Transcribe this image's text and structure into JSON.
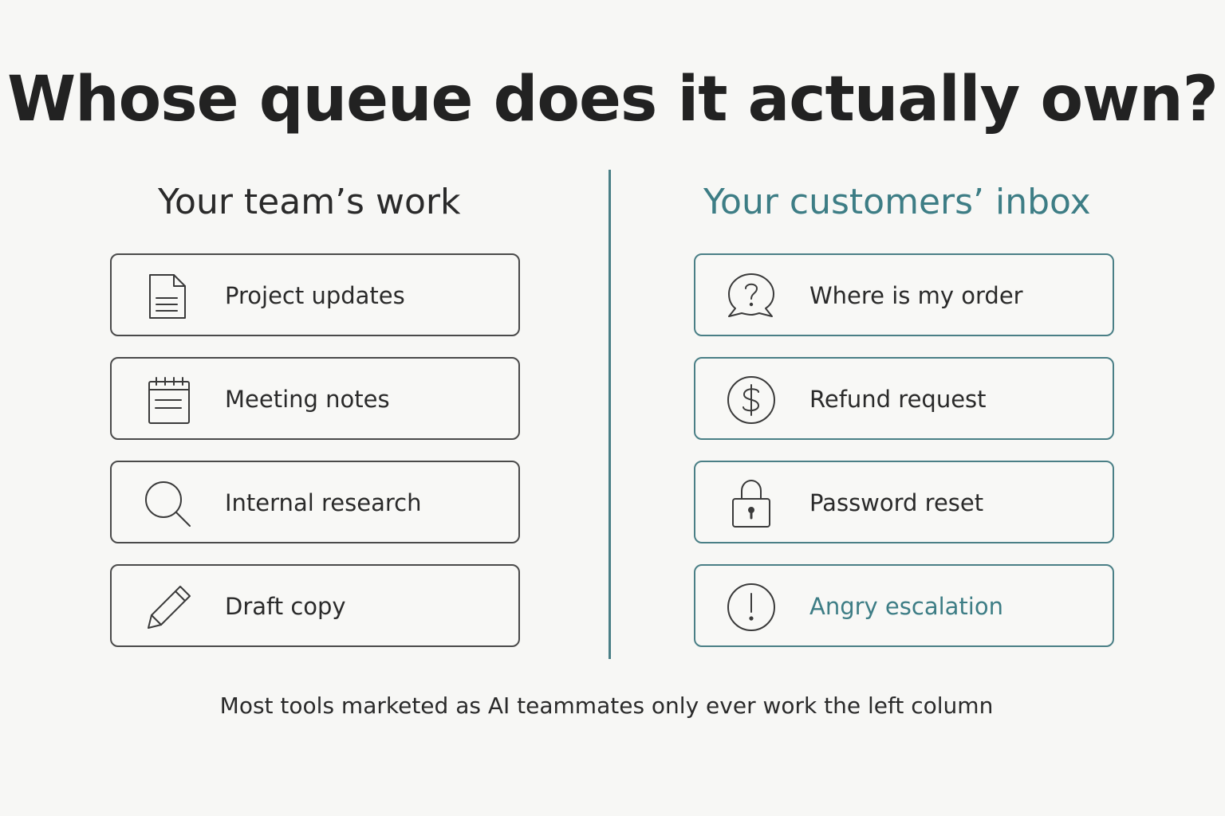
{
  "title": "Whose queue does it actually own?",
  "left_column": {
    "heading": "Your team’s work",
    "items": [
      {
        "label": "Project updates",
        "icon": "document-icon"
      },
      {
        "label": "Meeting notes",
        "icon": "notepad-icon"
      },
      {
        "label": "Internal research",
        "icon": "search-icon"
      },
      {
        "label": "Draft copy",
        "icon": "pencil-icon"
      }
    ]
  },
  "right_column": {
    "heading": "Your customers’ inbox",
    "items": [
      {
        "label": "Where is my order",
        "icon": "question-bubble-icon"
      },
      {
        "label": "Refund request",
        "icon": "dollar-icon"
      },
      {
        "label": "Password reset",
        "icon": "lock-icon"
      },
      {
        "label": "Angry escalation",
        "icon": "alert-icon"
      }
    ]
  },
  "footer": "Most tools marketed as AI teammates only ever work the left column",
  "colors": {
    "background": "#f7f7f5",
    "text": "#2a2a2a",
    "accent": "#3d7d85",
    "left_border": "#4a4a4a",
    "right_border": "#4a7f86"
  }
}
